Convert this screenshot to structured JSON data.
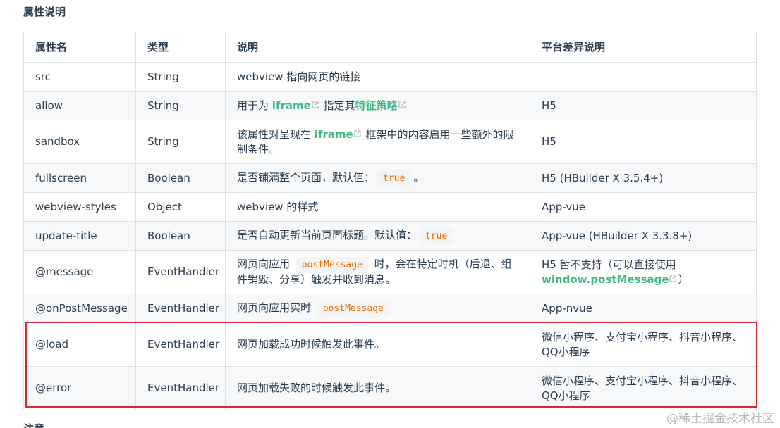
{
  "section_title": "属性说明",
  "table": {
    "headers": [
      "属性名",
      "类型",
      "说明",
      "平台差异说明"
    ],
    "rows": [
      {
        "name": "src",
        "type": "String",
        "desc_text": "webview 指向网页的链接",
        "platform": ""
      },
      {
        "name": "allow",
        "type": "String",
        "desc_pre": "用于为 ",
        "desc_link1": "iframe",
        "desc_mid": " 指定其",
        "desc_link2": "特征策略",
        "platform": "H5"
      },
      {
        "name": "sandbox",
        "type": "String",
        "desc_pre": "该属性对呈现在 ",
        "desc_link1": "iframe",
        "desc_post": " 框架中的内容启用一些额外的限制条件。",
        "platform": "H5"
      },
      {
        "name": "fullscreen",
        "type": "Boolean",
        "desc_pre": "是否铺满整个页面，默认值：",
        "desc_code": "true",
        "desc_post": "。",
        "platform": "H5 (HBuilder X 3.5.4+)"
      },
      {
        "name": "webview-styles",
        "type": "Object",
        "desc_text": "webview 的样式",
        "platform": "App-vue"
      },
      {
        "name": "update-title",
        "type": "Boolean",
        "desc_pre": "是否自动更新当前页面标题。默认值：",
        "desc_code": "true",
        "platform": "App-vue (HBuilder X 3.3.8+)"
      },
      {
        "name": "@message",
        "type": "EventHandler",
        "desc_pre": "网页向应用 ",
        "desc_code": "postMessage",
        "desc_post": " 时，会在特定时机（后退、组件销毁、分享）触发并收到消息。",
        "platform_pre": "H5 暂不支持（可以直接使用 ",
        "platform_link": "window.postMessage",
        "platform_post": "）"
      },
      {
        "name": "@onPostMessage",
        "type": "EventHandler",
        "desc_pre": "网页向应用实时 ",
        "desc_code": "postMessage",
        "platform": "App-nvue"
      },
      {
        "name": "@load",
        "type": "EventHandler",
        "desc_text": "网页加载成功时候触发此事件。",
        "platform": "微信小程序、支付宝小程序、抖音小程序、QQ小程序"
      },
      {
        "name": "@error",
        "type": "EventHandler",
        "desc_text": "网页加载失败的时候触发此事件。",
        "platform": "微信小程序、支付宝小程序、抖音小程序、QQ小程序"
      }
    ]
  },
  "next_heading": "注意",
  "watermark": "@稀土掘金技术社区",
  "colors": {
    "link": "#42b983",
    "code": "#e96900",
    "highlight": "#e0252d",
    "border": "#dfe2e5",
    "stripe": "#f6f8fa"
  },
  "icons": [
    "external-link-icon"
  ]
}
